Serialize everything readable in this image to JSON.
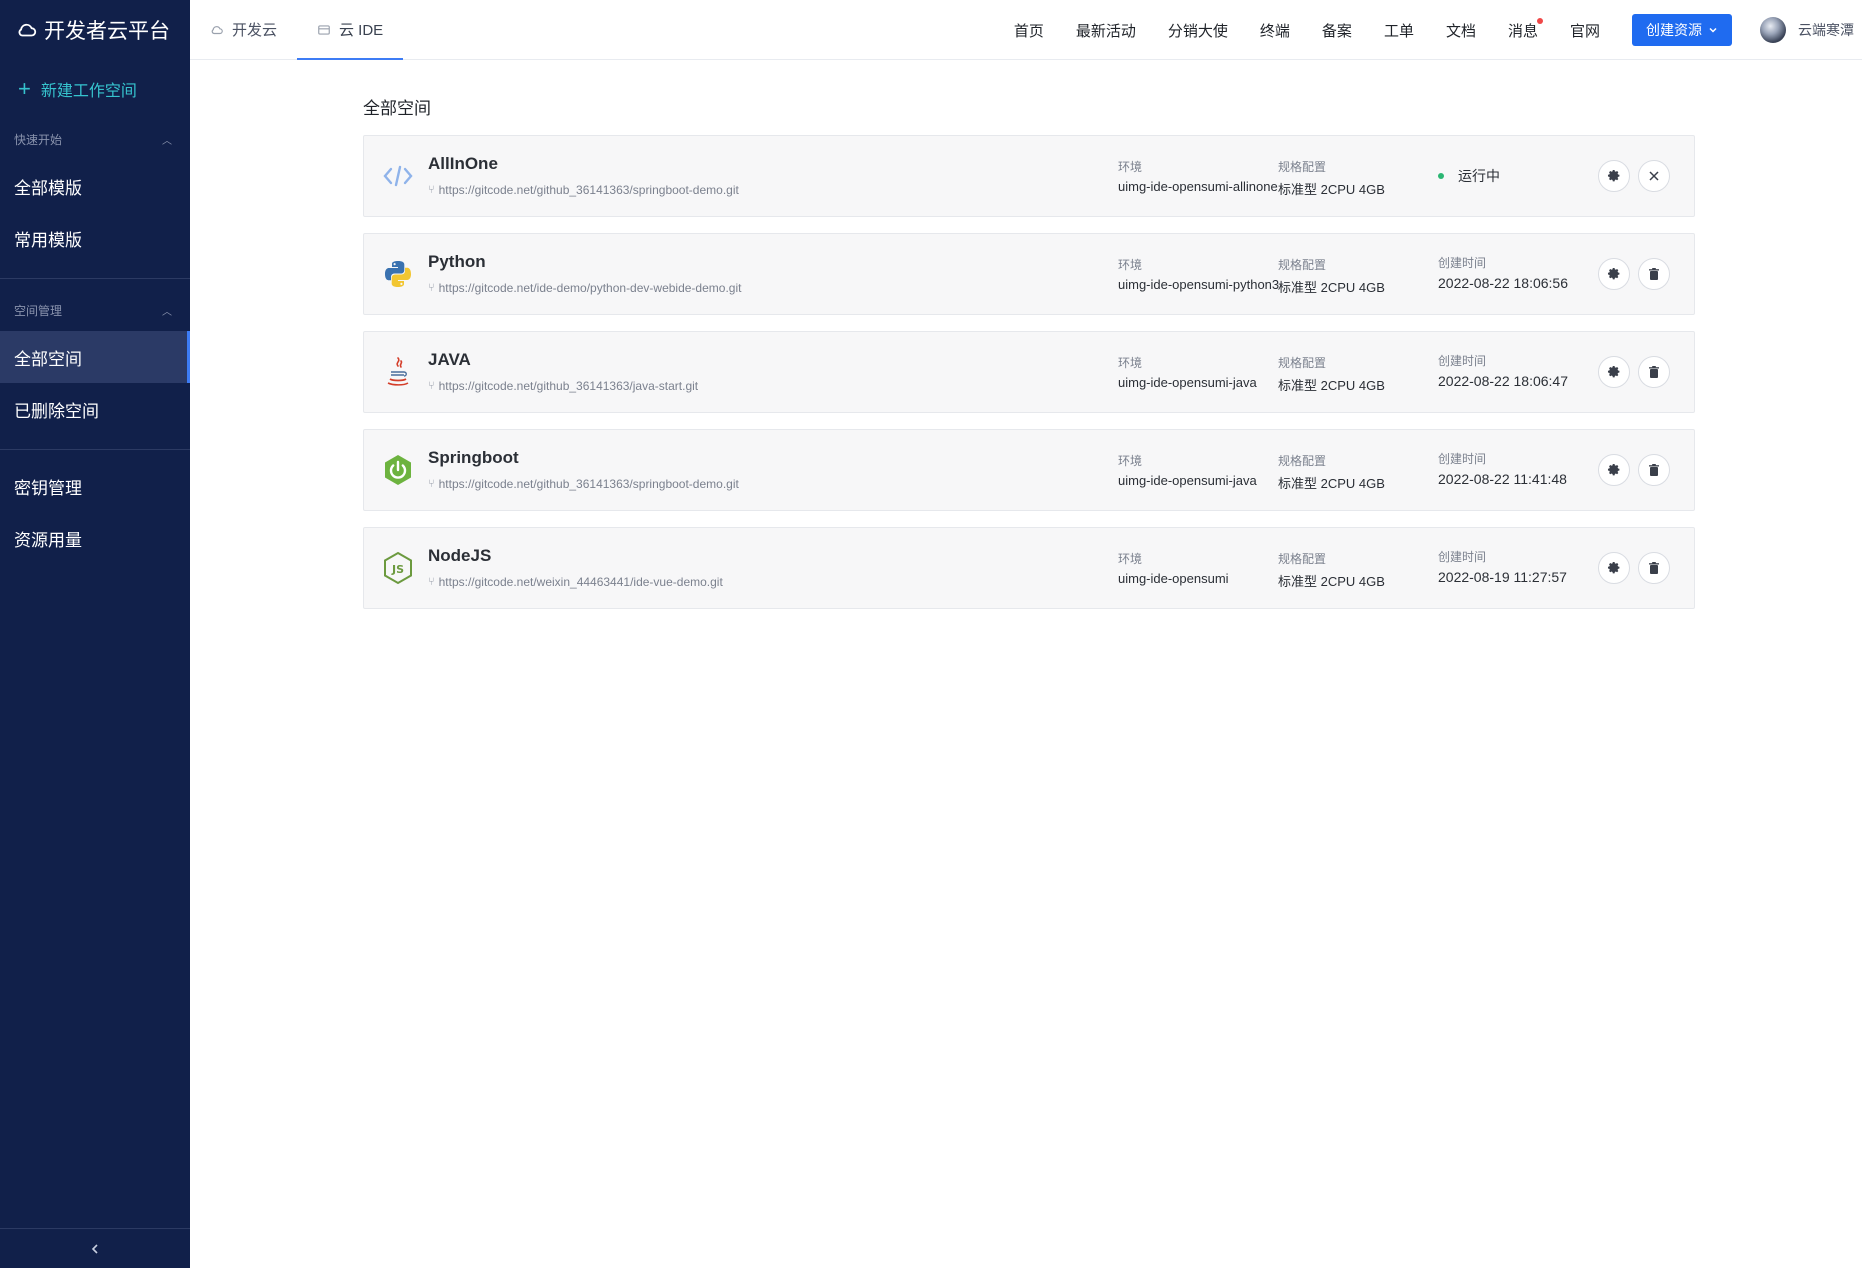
{
  "brand": {
    "title": "开发者云平台"
  },
  "sidebar": {
    "new_workspace": "新建工作空间",
    "groups": [
      {
        "title": "快速开始",
        "items": [
          "全部模版",
          "常用模版"
        ]
      },
      {
        "title": "空间管理",
        "items": [
          "全部空间",
          "已删除空间"
        ]
      }
    ],
    "extra_items": [
      "密钥管理",
      "资源用量"
    ],
    "active_item": "全部空间"
  },
  "header": {
    "tabs": [
      {
        "label": "开发云",
        "icon": "cloud-icon",
        "active": false
      },
      {
        "label": "云 IDE",
        "icon": "ide-icon",
        "active": true
      }
    ],
    "nav": [
      "首页",
      "最新活动",
      "分销大使",
      "终端",
      "备案",
      "工单",
      "文档",
      "消息",
      "官网"
    ],
    "create_button": "创建资源",
    "user_name": "云端寒潭",
    "colors": {
      "accent": "#1f6bf0",
      "sidebar_bg": "#11204a",
      "new_workspace": "#36c3ce",
      "running": "#2bb673"
    }
  },
  "main": {
    "title": "全部空间",
    "labels": {
      "env": "环境",
      "spec": "规格配置",
      "created": "创建时间"
    },
    "workspaces": [
      {
        "name": "AllInOne",
        "repo": "https://gitcode.net/github_36141363/springboot-demo.git",
        "env": "uimg-ide-opensumi-allinone",
        "spec": "标准型 2CPU 4GB",
        "status": "运行中",
        "created": "",
        "icon": "code-icon",
        "action": "close-icon"
      },
      {
        "name": "Python",
        "repo": "https://gitcode.net/ide-demo/python-dev-webide-demo.git",
        "env": "uimg-ide-opensumi-python3",
        "spec": "标准型 2CPU 4GB",
        "status": "",
        "created": "2022-08-22 18:06:56",
        "icon": "python-icon",
        "action": "trash-icon"
      },
      {
        "name": "JAVA",
        "repo": "https://gitcode.net/github_36141363/java-start.git",
        "env": "uimg-ide-opensumi-java",
        "spec": "标准型 2CPU 4GB",
        "status": "",
        "created": "2022-08-22 18:06:47",
        "icon": "java-icon",
        "action": "trash-icon"
      },
      {
        "name": "Springboot",
        "repo": "https://gitcode.net/github_36141363/springboot-demo.git",
        "env": "uimg-ide-opensumi-java",
        "spec": "标准型 2CPU 4GB",
        "status": "",
        "created": "2022-08-22 11:41:48",
        "icon": "springboot-icon",
        "action": "trash-icon"
      },
      {
        "name": "NodeJS",
        "repo": "https://gitcode.net/weixin_44463441/ide-vue-demo.git",
        "env": "uimg-ide-opensumi",
        "spec": "标准型 2CPU 4GB",
        "status": "",
        "created": "2022-08-19 11:27:57",
        "icon": "nodejs-icon",
        "action": "trash-icon"
      }
    ]
  }
}
